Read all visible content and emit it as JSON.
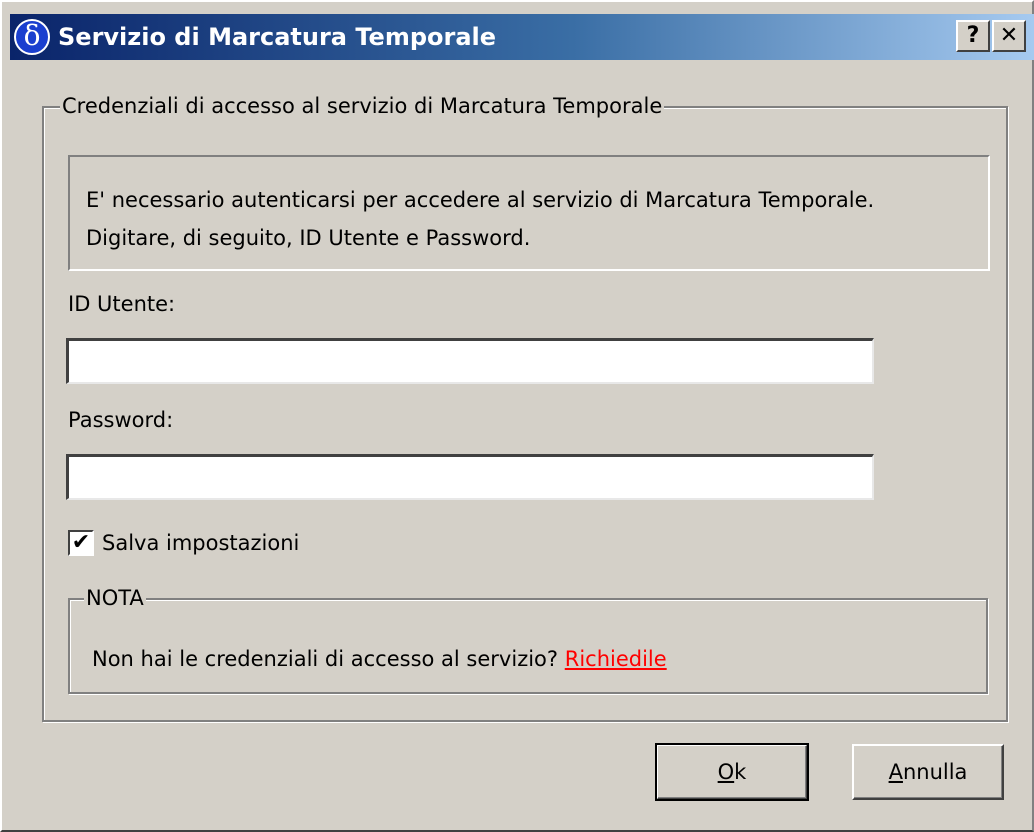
{
  "window": {
    "title": "Servizio di Marcatura Temporale",
    "app_icon": "delta-icon",
    "help_label": "?",
    "close_label": "✕"
  },
  "credentials_group": {
    "legend": "Credenziali di accesso al servizio di Marcatura Temporale",
    "info_line1": "E' necessario autenticarsi per accedere al servizio di Marcatura Temporale.",
    "info_line2": "Digitare, di seguito, ID Utente e Password.",
    "user_label": "ID Utente:",
    "user_value": "",
    "password_label": "Password:",
    "password_value": "",
    "save_settings_label": "Salva impostazioni",
    "save_settings_checked": true
  },
  "note_group": {
    "legend": "NOTA",
    "text": "Non hai le credenziali di accesso al servizio?",
    "link": "Richiedile"
  },
  "buttons": {
    "ok_first": "O",
    "ok_rest": "k",
    "cancel_first": "A",
    "cancel_rest": "nnulla"
  }
}
